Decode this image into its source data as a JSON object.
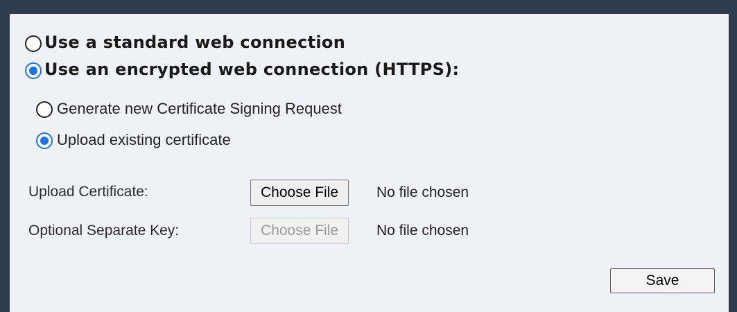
{
  "connection": {
    "standard_label": "Use a standard web connection",
    "https_label": "Use an encrypted web connection (HTTPS):",
    "selected": "https"
  },
  "certificate": {
    "generate_csr_label": "Generate new Certificate Signing Request",
    "upload_existing_label": "Upload existing certificate",
    "selected": "upload_existing"
  },
  "upload": {
    "certificate_label": "Upload Certificate:",
    "certificate_button": "Choose File",
    "certificate_status": "No file chosen",
    "key_label": "Optional Separate Key:",
    "key_button": "Choose File",
    "key_status": "No file chosen",
    "key_button_disabled": true
  },
  "actions": {
    "save_label": "Save"
  },
  "colors": {
    "accent": "#1a73e8",
    "frame": "#2e3d4d",
    "panel": "#eef1f5"
  }
}
